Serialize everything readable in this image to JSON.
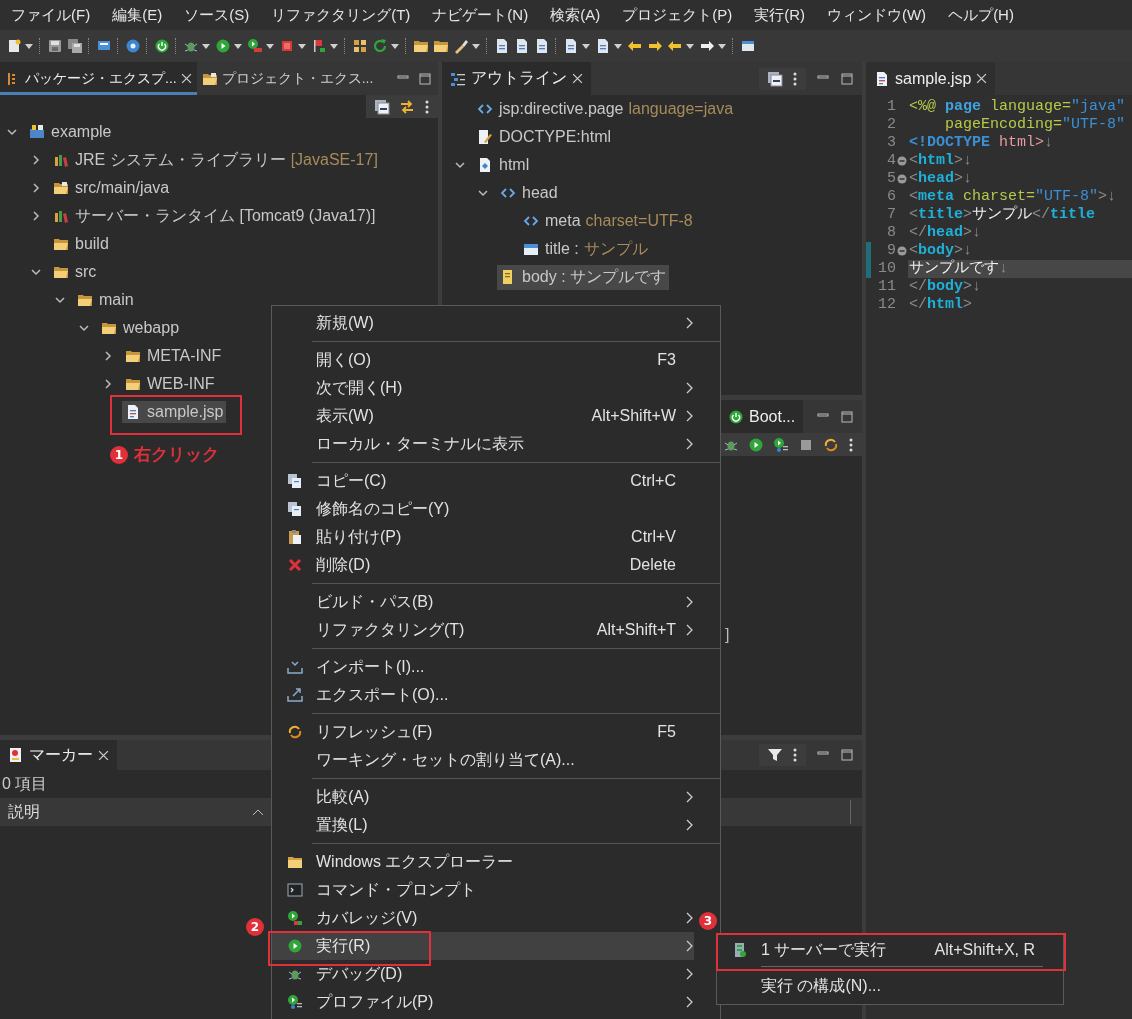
{
  "menu_bar": [
    "ファイル(F)",
    "編集(E)",
    "ソース(S)",
    "リファクタリング(T)",
    "ナビゲート(N)",
    "検索(A)",
    "プロジェクト(P)",
    "実行(R)",
    "ウィンドウ(W)",
    "ヘルプ(H)"
  ],
  "package_explorer": {
    "tabs": [
      {
        "label": "パッケージ・エクスプ...",
        "selected": true
      },
      {
        "label": "プロジェクト・エクス...",
        "selected": false
      }
    ],
    "tree": [
      {
        "label": "example",
        "kind": "project",
        "expanded": true,
        "selected": false,
        "children": [
          {
            "label": "JRE システム・ライブラリー",
            "detail": "[JavaSE-17]",
            "kind": "library",
            "expanded": false,
            "selected": false
          },
          {
            "label": "src/main/java",
            "kind": "source-folder",
            "expanded": false,
            "selected": false
          },
          {
            "label": "サーバー・ランタイム [Tomcat9 (Java17)]",
            "kind": "library",
            "expanded": false,
            "selected": false
          },
          {
            "label": "build",
            "kind": "folder",
            "selected": false
          },
          {
            "label": "src",
            "kind": "folder",
            "expanded": true,
            "selected": false,
            "children": [
              {
                "label": "main",
                "kind": "folder",
                "expanded": true,
                "selected": false,
                "children": [
                  {
                    "label": "webapp",
                    "kind": "folder",
                    "expanded": true,
                    "selected": false,
                    "children": [
                      {
                        "label": "META-INF",
                        "kind": "folder",
                        "expanded": false,
                        "selected": false
                      },
                      {
                        "label": "WEB-INF",
                        "kind": "folder",
                        "expanded": false,
                        "selected": false
                      },
                      {
                        "label": "sample.jsp",
                        "kind": "file",
                        "selected": true
                      }
                    ]
                  }
                ]
              }
            ]
          }
        ]
      }
    ]
  },
  "outline": {
    "tab": {
      "label": "アウトライン",
      "selected": true
    },
    "tree": [
      {
        "label": "jsp:directive.page",
        "detail": "language=java",
        "kind": "tag",
        "selected": false
      },
      {
        "label": "DOCTYPE:html",
        "kind": "doctype",
        "selected": false
      },
      {
        "label": "html",
        "kind": "root",
        "expanded": true,
        "selected": false,
        "children": [
          {
            "label": "head",
            "kind": "tag",
            "expanded": true,
            "selected": false,
            "children": [
              {
                "label": "meta",
                "detail": "charset=UTF-8",
                "kind": "tag",
                "selected": false
              },
              {
                "label": "title :",
                "detail": "サンプル",
                "kind": "text-element",
                "selected": false
              }
            ]
          },
          {
            "label": "body : サンプルです",
            "kind": "body",
            "selected": true
          }
        ]
      }
    ]
  },
  "boot_panel": {
    "tab": {
      "label": "Boot...",
      "selected": true
    },
    "fragment": "]"
  },
  "markers": {
    "tab": {
      "label": "マーカー",
      "selected": true
    },
    "summary": "0 項目",
    "columns": [
      {
        "label": "説明"
      }
    ]
  },
  "editor": {
    "tab": {
      "label": "sample.jsp",
      "selected": true
    },
    "lines": [
      {
        "number": "1",
        "foldable": false,
        "changed": false,
        "current": false,
        "tokens": [
          {
            "text": "<%@",
            "kind": "directive"
          },
          {
            "text": " page",
            "kind": "keyword"
          },
          {
            "text": " language=",
            "kind": "attr"
          },
          {
            "text": "\"java\"",
            "kind": "value"
          }
        ]
      },
      {
        "number": "2",
        "foldable": false,
        "changed": false,
        "current": false,
        "tokens": [
          {
            "text": "    pageEncoding=",
            "kind": "attr"
          },
          {
            "text": "\"UTF-8\"",
            "kind": "value"
          }
        ]
      },
      {
        "number": "3",
        "foldable": false,
        "changed": false,
        "current": false,
        "tokens": [
          {
            "text": "<!DOCTYPE",
            "kind": "doctype"
          },
          {
            "text": " html>",
            "kind": "doctype-name"
          },
          {
            "text": "↓",
            "kind": "eol"
          }
        ]
      },
      {
        "number": "4",
        "foldable": true,
        "changed": false,
        "current": false,
        "tokens": [
          {
            "text": "<",
            "kind": "bracket"
          },
          {
            "text": "html",
            "kind": "tag"
          },
          {
            "text": ">",
            "kind": "bracket"
          },
          {
            "text": "↓",
            "kind": "eol"
          }
        ]
      },
      {
        "number": "5",
        "foldable": true,
        "changed": false,
        "current": false,
        "tokens": [
          {
            "text": "<",
            "kind": "bracket"
          },
          {
            "text": "head",
            "kind": "tag"
          },
          {
            "text": ">",
            "kind": "bracket"
          },
          {
            "text": "↓",
            "kind": "eol"
          }
        ]
      },
      {
        "number": "6",
        "foldable": false,
        "changed": false,
        "current": false,
        "tokens": [
          {
            "text": "<",
            "kind": "bracket"
          },
          {
            "text": "meta",
            "kind": "tag"
          },
          {
            "text": " charset=",
            "kind": "attr"
          },
          {
            "text": "\"UTF-8\"",
            "kind": "value"
          },
          {
            "text": ">",
            "kind": "bracket"
          },
          {
            "text": "↓",
            "kind": "eol"
          }
        ]
      },
      {
        "number": "7",
        "foldable": false,
        "changed": false,
        "current": false,
        "tokens": [
          {
            "text": "<",
            "kind": "bracket"
          },
          {
            "text": "title",
            "kind": "tag"
          },
          {
            "text": ">",
            "kind": "bracket"
          },
          {
            "text": "サンプル",
            "kind": "text"
          },
          {
            "text": "</",
            "kind": "bracket"
          },
          {
            "text": "title",
            "kind": "tag"
          }
        ]
      },
      {
        "number": "8",
        "foldable": false,
        "changed": false,
        "current": false,
        "tokens": [
          {
            "text": "</",
            "kind": "bracket"
          },
          {
            "text": "head",
            "kind": "tag"
          },
          {
            "text": ">",
            "kind": "bracket"
          },
          {
            "text": "↓",
            "kind": "eol"
          }
        ]
      },
      {
        "number": "9",
        "foldable": true,
        "changed": true,
        "current": false,
        "tokens": [
          {
            "text": "<",
            "kind": "bracket"
          },
          {
            "text": "body",
            "kind": "tag"
          },
          {
            "text": ">",
            "kind": "bracket"
          },
          {
            "text": "↓",
            "kind": "eol"
          }
        ]
      },
      {
        "number": "10",
        "foldable": false,
        "changed": true,
        "current": true,
        "tokens": [
          {
            "text": "サンプルです",
            "kind": "text"
          },
          {
            "text": "↓",
            "kind": "eol"
          }
        ]
      },
      {
        "number": "11",
        "foldable": false,
        "changed": false,
        "current": false,
        "tokens": [
          {
            "text": "</",
            "kind": "bracket"
          },
          {
            "text": "body",
            "kind": "tag"
          },
          {
            "text": ">",
            "kind": "bracket"
          },
          {
            "text": "↓",
            "kind": "eol"
          }
        ]
      },
      {
        "number": "12",
        "foldable": false,
        "changed": false,
        "current": false,
        "tokens": [
          {
            "text": "</",
            "kind": "bracket"
          },
          {
            "text": "html",
            "kind": "tag"
          },
          {
            "text": ">",
            "kind": "bracket"
          }
        ]
      }
    ]
  },
  "context_menu": {
    "items": [
      {
        "kind": "plain",
        "label": "新規(W)",
        "submenu": true,
        "selected": false
      },
      {
        "kind": "separator"
      },
      {
        "kind": "plain",
        "label": "開く(O)",
        "shortcut": "F3",
        "submenu": false,
        "selected": false
      },
      {
        "kind": "plain",
        "label": "次で開く(H)",
        "submenu": true,
        "selected": false
      },
      {
        "kind": "plain",
        "label": "表示(W)",
        "shortcut": "Alt+Shift+W",
        "submenu": true,
        "selected": false
      },
      {
        "kind": "plain",
        "label": "ローカル・ターミナルに表示",
        "submenu": true,
        "selected": false
      },
      {
        "kind": "separator"
      },
      {
        "kind": "copy",
        "label": "コピー(C)",
        "shortcut": "Ctrl+C",
        "submenu": false,
        "selected": false
      },
      {
        "kind": "qualified-copy",
        "label": "修飾名のコピー(Y)",
        "submenu": false,
        "selected": false
      },
      {
        "kind": "paste",
        "label": "貼り付け(P)",
        "shortcut": "Ctrl+V",
        "submenu": false,
        "selected": false
      },
      {
        "kind": "delete",
        "label": "削除(D)",
        "shortcut": "Delete",
        "submenu": false,
        "selected": false
      },
      {
        "kind": "separator"
      },
      {
        "kind": "plain",
        "label": "ビルド・パス(B)",
        "submenu": true,
        "selected": false
      },
      {
        "kind": "plain",
        "label": "リファクタリング(T)",
        "shortcut": "Alt+Shift+T",
        "submenu": true,
        "selected": false
      },
      {
        "kind": "separator"
      },
      {
        "kind": "import",
        "label": "インポート(I)...",
        "submenu": false,
        "selected": false
      },
      {
        "kind": "export",
        "label": "エクスポート(O)...",
        "submenu": false,
        "selected": false
      },
      {
        "kind": "separator"
      },
      {
        "kind": "refresh",
        "label": "リフレッシュ(F)",
        "shortcut": "F5",
        "submenu": false,
        "selected": false
      },
      {
        "kind": "plain",
        "label": "ワーキング・セットの割り当て(A)...",
        "submenu": false,
        "selected": false
      },
      {
        "kind": "separator"
      },
      {
        "kind": "plain",
        "label": "比較(A)",
        "submenu": true,
        "selected": false
      },
      {
        "kind": "plain",
        "label": "置換(L)",
        "submenu": true,
        "selected": false
      },
      {
        "kind": "separator"
      },
      {
        "kind": "explorer",
        "label": "Windows エクスプローラー",
        "submenu": false,
        "selected": false
      },
      {
        "kind": "terminal",
        "label": "コマンド・プロンプト",
        "submenu": false,
        "selected": false
      },
      {
        "kind": "coverage",
        "label": "カバレッジ(V)",
        "submenu": true,
        "selected": false
      },
      {
        "kind": "run",
        "label": "実行(R)",
        "submenu": true,
        "selected": true
      },
      {
        "kind": "debug",
        "label": "デバッグ(D)",
        "submenu": true,
        "selected": false
      },
      {
        "kind": "profile",
        "label": "プロファイル(P)",
        "submenu": true,
        "selected": false
      }
    ]
  },
  "submenu": {
    "items": [
      {
        "kind": "server-run",
        "label": "1 サーバーで実行",
        "shortcut": "Alt+Shift+X, R"
      },
      {
        "kind": "separator"
      },
      {
        "kind": "plain",
        "label": "実行 の構成(N)..."
      }
    ]
  },
  "annotations": [
    {
      "number": "1",
      "label": "右クリック"
    },
    {
      "number": "2"
    },
    {
      "number": "3"
    }
  ]
}
